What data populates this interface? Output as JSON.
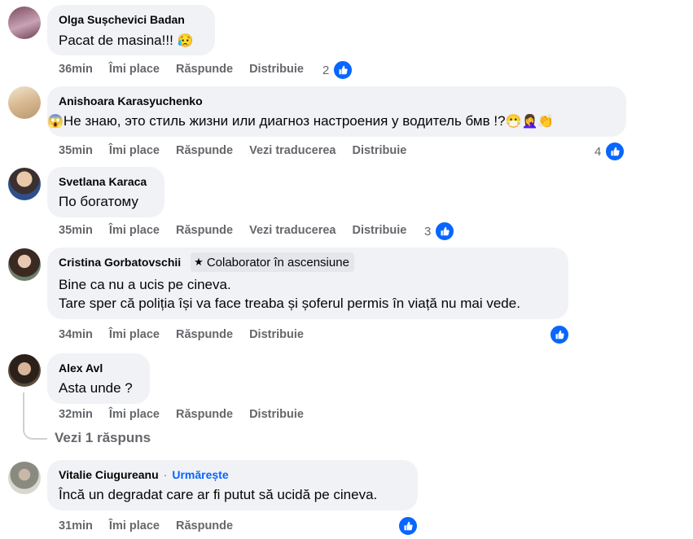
{
  "comments": [
    {
      "author": "Olga Sușchevici Badan",
      "lines": [
        "Pacat de masina!!!"
      ],
      "emoji_after": "😥",
      "time": "36min",
      "like": "Îmi place",
      "reply": "Răspunde",
      "share": "Distribuie",
      "reaction_count": "2"
    },
    {
      "author": "Anishoara Karasyuchenko",
      "lines": [
        "Не знаю, это стиль жизни или диагноз настроения у водитель бмв !?"
      ],
      "emoji_before": "😱",
      "emoji_after": "😷🤦‍♀️👏",
      "time": "35min",
      "like": "Îmi place",
      "reply": "Răspunde",
      "translate": "Vezi traducerea",
      "share": "Distribuie",
      "reaction_count": "4"
    },
    {
      "author": "Svetlana Karaca",
      "lines": [
        "По богатому"
      ],
      "time": "35min",
      "like": "Îmi place",
      "reply": "Răspunde",
      "translate": "Vezi traducerea",
      "share": "Distribuie",
      "reaction_count": "3"
    },
    {
      "author": "Cristina Gorbatovschii",
      "badge": "Colaborator în ascensiune",
      "lines": [
        "Bine ca nu a ucis pe cineva.",
        "Tare sper că poliția își va face treaba și șoferul permis în viață nu mai vede."
      ],
      "time": "34min",
      "like": "Îmi place",
      "reply": "Răspunde",
      "share": "Distribuie"
    },
    {
      "author": "Alex Avl",
      "lines": [
        "Asta unde ?"
      ],
      "time": "32min",
      "like": "Îmi place",
      "reply": "Răspunde",
      "share": "Distribuie"
    },
    {
      "author": "Vitalie Ciugureanu",
      "follow_separator": "·",
      "follow": "Urmărește",
      "lines": [
        "Încă un degradat care ar fi putut să ucidă pe cineva."
      ],
      "time": "31min",
      "like": "Îmi place",
      "reply": "Răspunde"
    }
  ],
  "view_replies": "Vezi 1 răspuns",
  "colors": {
    "bubble": "#f0f2f5",
    "accent": "#0866ff",
    "meta": "#65676b"
  },
  "icons": {
    "reaction": "thumbs-up-icon",
    "badge": "star-badge-icon"
  }
}
